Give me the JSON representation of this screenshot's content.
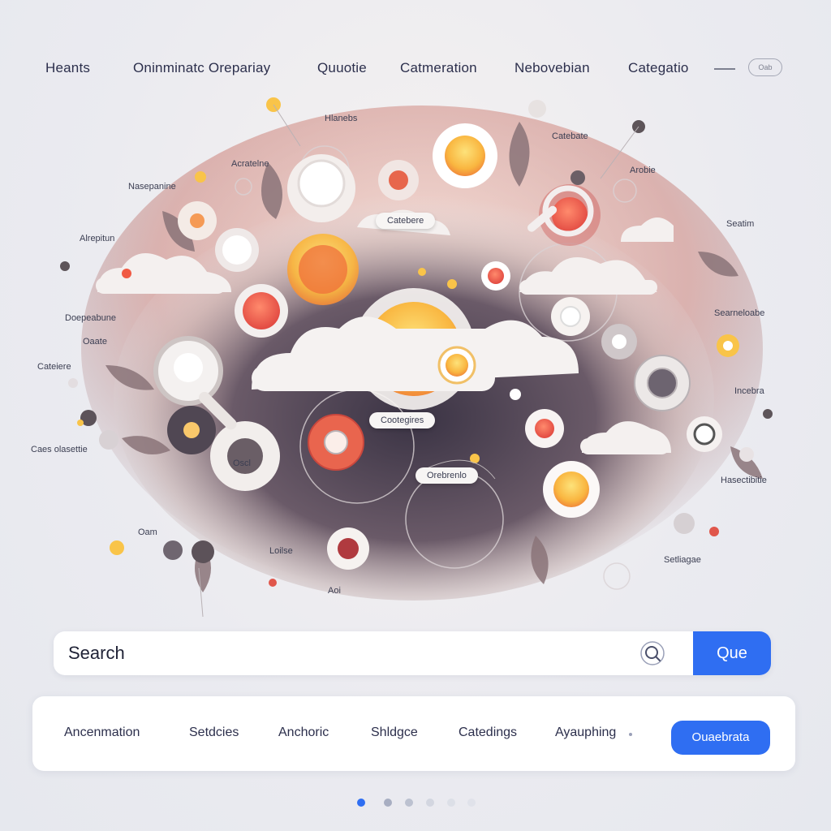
{
  "nav": {
    "items": [
      "Heants",
      "Oninminatc Orepariay",
      "Quuotie",
      "Catmeration",
      "Nebovebian",
      "Categatio"
    ],
    "pill_label": "Oab"
  },
  "illustration": {
    "labels": [
      "Hlanebs",
      "Catebate",
      "Acratelne",
      "Arobie",
      "Nasepanine",
      "Seatim",
      "Alrepitun",
      "Catebere",
      "Doepeabune",
      "Searneloabe",
      "Oaate",
      "Cateiere",
      "Incebra",
      "Caes olasettie",
      "Hasectibitie",
      "Oam",
      "Loilse",
      "Aoi",
      "Setliagae",
      "Cootegires",
      "Orebrenlo",
      "Oscl"
    ],
    "accent_colors": [
      "#f9c449",
      "#ef5e48",
      "#5a4f59",
      "#f4ede8"
    ]
  },
  "search": {
    "placeholder": "Search",
    "button_label": "Que"
  },
  "categories": {
    "items": [
      "Ancenmation",
      "Setdcies",
      "Anchoric",
      "Shldgce",
      "Catedings",
      "Ayauphing"
    ],
    "button_label": "Ouaebrata"
  },
  "pagination": {
    "total": 6,
    "active": 1
  },
  "colors": {
    "primary": "#2f6ef2",
    "text": "#2c2f4c",
    "background": "#ebebf0"
  }
}
